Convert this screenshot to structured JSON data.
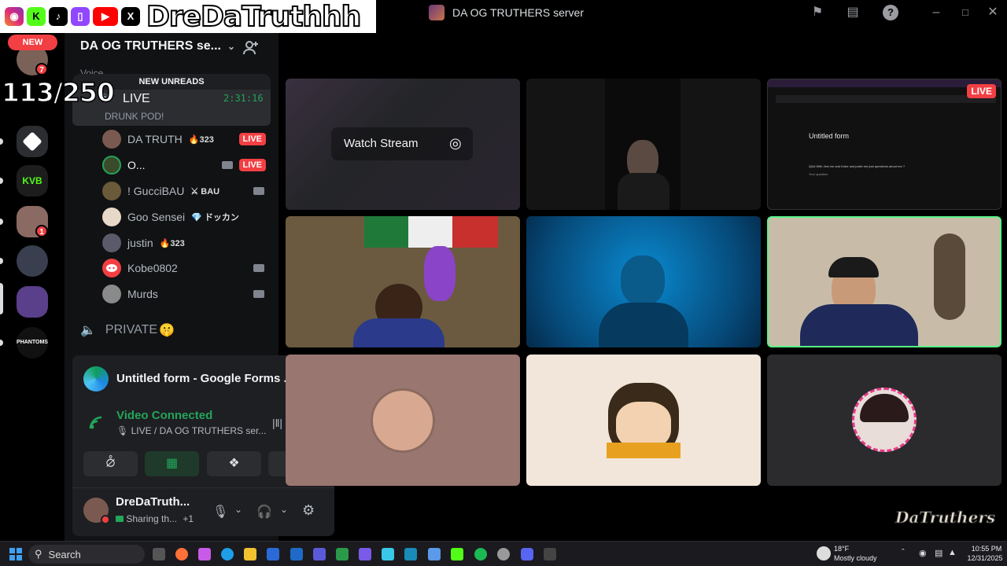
{
  "window": {
    "server_title": "DA OG TRUTHERS server"
  },
  "overlay": {
    "name": "DreDaTruthhh",
    "counter": "113/250",
    "new_pill": "NEW",
    "social_icons": [
      "instagram-icon",
      "kick-icon",
      "tiktok-icon",
      "twitch-icon",
      "youtube-icon",
      "x-icon"
    ]
  },
  "rail": {
    "badges": [
      "7",
      "1"
    ],
    "server_labels": [
      "KVB",
      "PHANTOMS"
    ]
  },
  "sidebar": {
    "server_name": "DA OG TRUTHERS se...",
    "voice_header": "Voice",
    "new_unreads": "NEW UNREADS",
    "live_channel": {
      "name": "LIVE",
      "timer": "2:31:16",
      "topic": "DRUNK POD!"
    },
    "members": [
      {
        "name": "DA TRUTH",
        "boost": "323",
        "live": "LIVE"
      },
      {
        "name": "O...",
        "live": "LIVE"
      },
      {
        "name": "! GucciBAU",
        "tag": "BAU"
      },
      {
        "name": "Goo Sensei",
        "tag": "ドッカン"
      },
      {
        "name": "justin",
        "boost": "323"
      },
      {
        "name": "Kobe0802"
      },
      {
        "name": "Murds"
      }
    ],
    "private_channel": "PRIVATE"
  },
  "stream_panel": {
    "title": "Untitled form - Google Forms ..."
  },
  "voice_panel": {
    "status": "Video Connected",
    "channel": "LIVE / DA OG TRUTHERS ser..."
  },
  "user_panel": {
    "name": "DreDaTruth...",
    "status": "Sharing th...",
    "extra": "+1"
  },
  "grid": {
    "watch_stream": "Watch Stream",
    "live_tag": "LIVE",
    "form_title": "Untitled form",
    "form_question": "Q&A With Jesi me and Kobe and justin me just questions about me ?",
    "form_prompt": "Your question"
  },
  "watermark": "DaTruthers",
  "taskbar": {
    "search": "Search",
    "weather_temp": "18°F",
    "weather_desc": "Mostly cloudy",
    "time": "10:55 PM",
    "date": "12/31/2025"
  },
  "colors": {
    "live": "#f23f43",
    "connected": "#23a55a",
    "speaking_border": "#57f287"
  }
}
